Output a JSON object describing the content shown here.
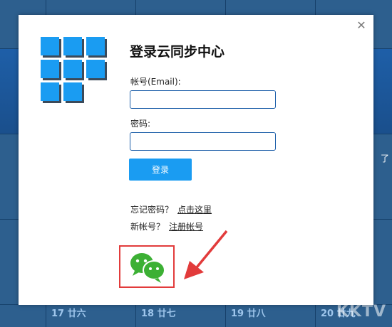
{
  "dialog": {
    "title": "登录云同步中心",
    "account_label": "帐号(Email):",
    "account_value": "",
    "password_label": "密码:",
    "password_value": "",
    "login_button": "登录",
    "forgot_text": "忘记密码？",
    "forgot_link": "点击这里",
    "new_account_text": "新帐号？",
    "register_link": "注册帐号",
    "close_icon": "close-icon",
    "wechat_icon": "wechat-icon"
  },
  "background": {
    "dates": [
      {
        "text": "17 廿六"
      },
      {
        "text": "18 廿七"
      },
      {
        "text": "19 廿八"
      },
      {
        "text": "20 廿九"
      }
    ],
    "side_text": "了",
    "watermark": "KKTV"
  },
  "colors": {
    "accent": "#1a9cf2",
    "highlight_box": "#e23b3b",
    "wechat_green": "#3cb034"
  }
}
